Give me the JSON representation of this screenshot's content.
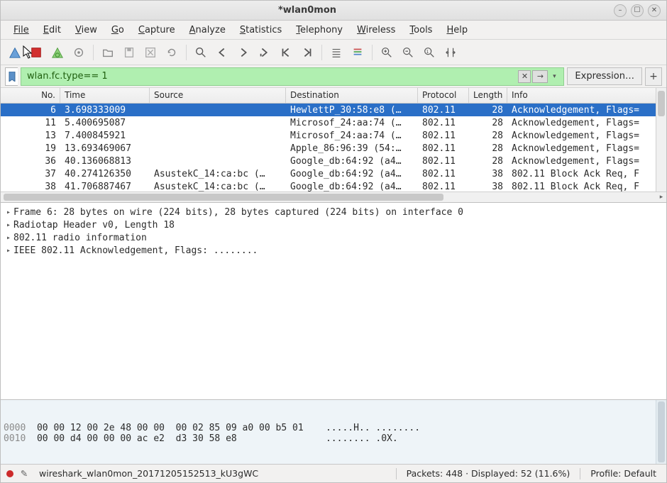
{
  "window": {
    "title": "*wlan0mon"
  },
  "menu": [
    "File",
    "Edit",
    "View",
    "Go",
    "Capture",
    "Analyze",
    "Statistics",
    "Telephony",
    "Wireless",
    "Tools",
    "Help"
  ],
  "filter": {
    "value": "wlan.fc.type== 1",
    "expression_label": "Expression…"
  },
  "columns": {
    "no": "No.",
    "time": "Time",
    "source": "Source",
    "destination": "Destination",
    "protocol": "Protocol",
    "length": "Length",
    "info": "Info"
  },
  "packets": [
    {
      "no": "6",
      "time": "3.698333009",
      "source": "",
      "destination": "HewlettP_30:58:e8 (…",
      "protocol": "802.11",
      "length": "28",
      "info": "Acknowledgement, Flags=",
      "selected": true
    },
    {
      "no": "11",
      "time": "5.400695087",
      "source": "",
      "destination": "Microsof_24:aa:74 (…",
      "protocol": "802.11",
      "length": "28",
      "info": "Acknowledgement, Flags="
    },
    {
      "no": "13",
      "time": "7.400845921",
      "source": "",
      "destination": "Microsof_24:aa:74 (…",
      "protocol": "802.11",
      "length": "28",
      "info": "Acknowledgement, Flags="
    },
    {
      "no": "19",
      "time": "13.693469067",
      "source": "",
      "destination": "Apple_86:96:39 (54:…",
      "protocol": "802.11",
      "length": "28",
      "info": "Acknowledgement, Flags="
    },
    {
      "no": "36",
      "time": "40.136068813",
      "source": "",
      "destination": "Google_db:64:92 (a4…",
      "protocol": "802.11",
      "length": "28",
      "info": "Acknowledgement, Flags="
    },
    {
      "no": "37",
      "time": "40.274126350",
      "source": "AsustekC_14:ca:bc (…",
      "destination": "Google_db:64:92 (a4…",
      "protocol": "802.11",
      "length": "38",
      "info": "802.11 Block Ack Req, F"
    },
    {
      "no": "38",
      "time": "41.706887467",
      "source": "AsustekC_14:ca:bc (…",
      "destination": "Google_db:64:92 (a4…",
      "protocol": "802.11",
      "length": "38",
      "info": "802.11 Block Ack Req, F"
    }
  ],
  "details": [
    "Frame 6: 28 bytes on wire (224 bits), 28 bytes captured (224 bits) on interface 0",
    "Radiotap Header v0, Length 18",
    "802.11 radio information",
    "IEEE 802.11 Acknowledgement, Flags: ........"
  ],
  "hex": {
    "lines": [
      {
        "offset": "0000",
        "bytes": "00 00 12 00 2e 48 00 00  00 02 85 09 a0 00 b5 01",
        "ascii": ".....H.. ........"
      },
      {
        "offset": "0010",
        "bytes": "00 00 d4 00 00 00 ac e2  d3 30 58 e8",
        "ascii": "........ .0X."
      }
    ]
  },
  "status": {
    "file": "wireshark_wlan0mon_20171205152513_kU3gWC",
    "packets": "Packets: 448 · Displayed: 52 (11.6%)",
    "profile": "Profile: Default"
  },
  "colors": {
    "selection": "#2a6fc7",
    "filter_valid_bg": "#b0efb0"
  }
}
